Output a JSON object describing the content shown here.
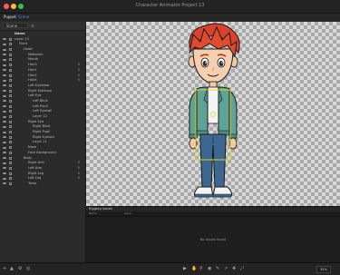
{
  "window": {
    "title": "Character Animator Project 13"
  },
  "panel_tabs": {
    "active": "Puppet",
    "secondary": "Scene"
  },
  "toolbar": {
    "puppet_select": "Scene"
  },
  "layer_tree": {
    "header": "Name",
    "rows": [
      {
        "label": "Layer 13",
        "indent": 0,
        "num": ""
      },
      {
        "label": "Front",
        "indent": 1,
        "num": ""
      },
      {
        "label": "Head",
        "indent": 2,
        "num": ""
      },
      {
        "label": "Midbrush",
        "indent": 3,
        "num": ""
      },
      {
        "label": "Mouth",
        "indent": 3,
        "num": ""
      },
      {
        "label": "Hair3",
        "indent": 3,
        "num": "0"
      },
      {
        "label": "Hair1",
        "indent": 3,
        "num": "0"
      },
      {
        "label": "Hair2",
        "indent": 3,
        "num": "0"
      },
      {
        "label": "Hair4",
        "indent": 3,
        "num": "0"
      },
      {
        "label": "Left Eyebrow",
        "indent": 3,
        "num": ""
      },
      {
        "label": "Right Eyebrow",
        "indent": 3,
        "num": ""
      },
      {
        "label": "Left Eye",
        "indent": 3,
        "num": ""
      },
      {
        "label": "Left Blink",
        "indent": 4,
        "num": ""
      },
      {
        "label": "Left Pupil",
        "indent": 4,
        "num": ""
      },
      {
        "label": "Left Eyeball",
        "indent": 4,
        "num": ""
      },
      {
        "label": "Layer 12",
        "indent": 4,
        "num": ""
      },
      {
        "label": "Right Eye",
        "indent": 3,
        "num": ""
      },
      {
        "label": "Right Blink",
        "indent": 4,
        "num": ""
      },
      {
        "label": "Right Pupil",
        "indent": 4,
        "num": ""
      },
      {
        "label": "Right Eyeball",
        "indent": 4,
        "num": ""
      },
      {
        "label": "Layer 11",
        "indent": 4,
        "num": ""
      },
      {
        "label": "Nose",
        "indent": 3,
        "num": ""
      },
      {
        "label": "Face Background",
        "indent": 3,
        "num": ""
      },
      {
        "label": "Body",
        "indent": 2,
        "num": ""
      },
      {
        "label": "Right Arm",
        "indent": 3,
        "num": "0"
      },
      {
        "label": "Left Arm",
        "indent": 3,
        "num": "0"
      },
      {
        "label": "Right Leg",
        "indent": 3,
        "num": "0"
      },
      {
        "label": "Left Leg",
        "indent": 3,
        "num": "0"
      },
      {
        "label": "Torso",
        "indent": 3,
        "num": ""
      }
    ]
  },
  "rigging": {
    "title": "Rigging Issues",
    "columns": [
      "Name",
      "Issue"
    ],
    "empty_message": "No issues found"
  },
  "statusbar": {
    "zoom": "35%"
  },
  "colors": {
    "accent": "#4d8fe8",
    "selection_box": "#e6d21d"
  }
}
